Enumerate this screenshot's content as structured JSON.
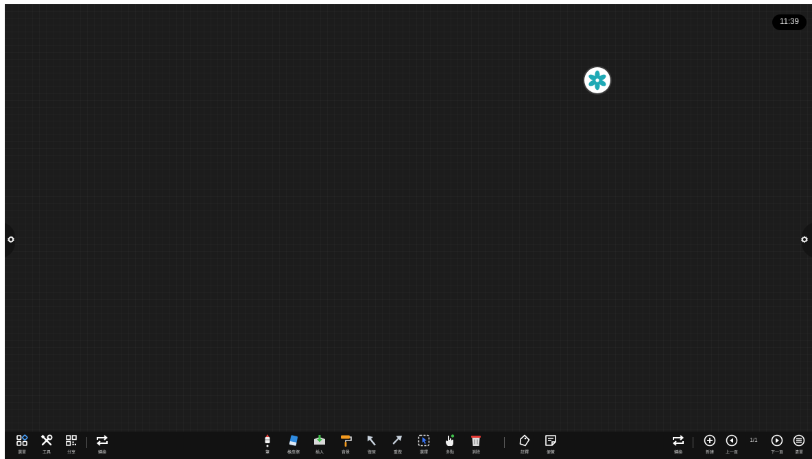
{
  "status": {
    "clock": "11:39"
  },
  "float_ball": {
    "icon": "flower-icon",
    "color": "#1fa9b5"
  },
  "left_group": [
    {
      "name": "menu-button",
      "icon": "menu-grid-icon",
      "label": "選單"
    },
    {
      "name": "tools-button",
      "icon": "tools-icon",
      "label": "工具"
    },
    {
      "name": "share-button",
      "icon": "qr-code-icon",
      "label": "分享"
    },
    {
      "name": "switch-button",
      "icon": "switch-arrows-icon",
      "label": "轉換"
    }
  ],
  "center_group": [
    {
      "name": "pen-button",
      "icon": "pen-icon",
      "label": "筆"
    },
    {
      "name": "eraser-button",
      "icon": "eraser-icon",
      "label": "橡皮擦"
    },
    {
      "name": "insert-button",
      "icon": "insert-icon",
      "label": "插入"
    },
    {
      "name": "background-button",
      "icon": "paint-roller-icon",
      "label": "背景"
    },
    {
      "name": "undo-button",
      "icon": "undo-arrow-icon",
      "label": "復原"
    },
    {
      "name": "redo-button",
      "icon": "redo-arrow-icon",
      "label": "重做"
    },
    {
      "name": "select-button",
      "icon": "select-icon",
      "label": "選擇"
    },
    {
      "name": "multi-touch-button",
      "icon": "multi-touch-hand-icon",
      "label": "多點"
    },
    {
      "name": "clear-button",
      "icon": "trash-icon",
      "label": "消除"
    },
    {
      "name": "annotate-button",
      "icon": "tag-icon",
      "label": "註釋"
    },
    {
      "name": "sticky-note-button",
      "icon": "sticky-note-icon",
      "label": "便簽"
    }
  ],
  "right_group": [
    {
      "name": "switch-right-button",
      "icon": "switch-arrows-icon",
      "label": "轉換"
    },
    {
      "name": "new-page-button",
      "icon": "plus-circle-icon",
      "label": "新建"
    },
    {
      "name": "prev-page-button",
      "icon": "prev-circle-icon",
      "label": "上一頁"
    },
    {
      "name": "next-page-button",
      "icon": "next-circle-icon",
      "label": "下一頁"
    },
    {
      "name": "page-list-button",
      "icon": "list-circle-icon",
      "label": "清單"
    }
  ],
  "page_indicator": "1/1"
}
